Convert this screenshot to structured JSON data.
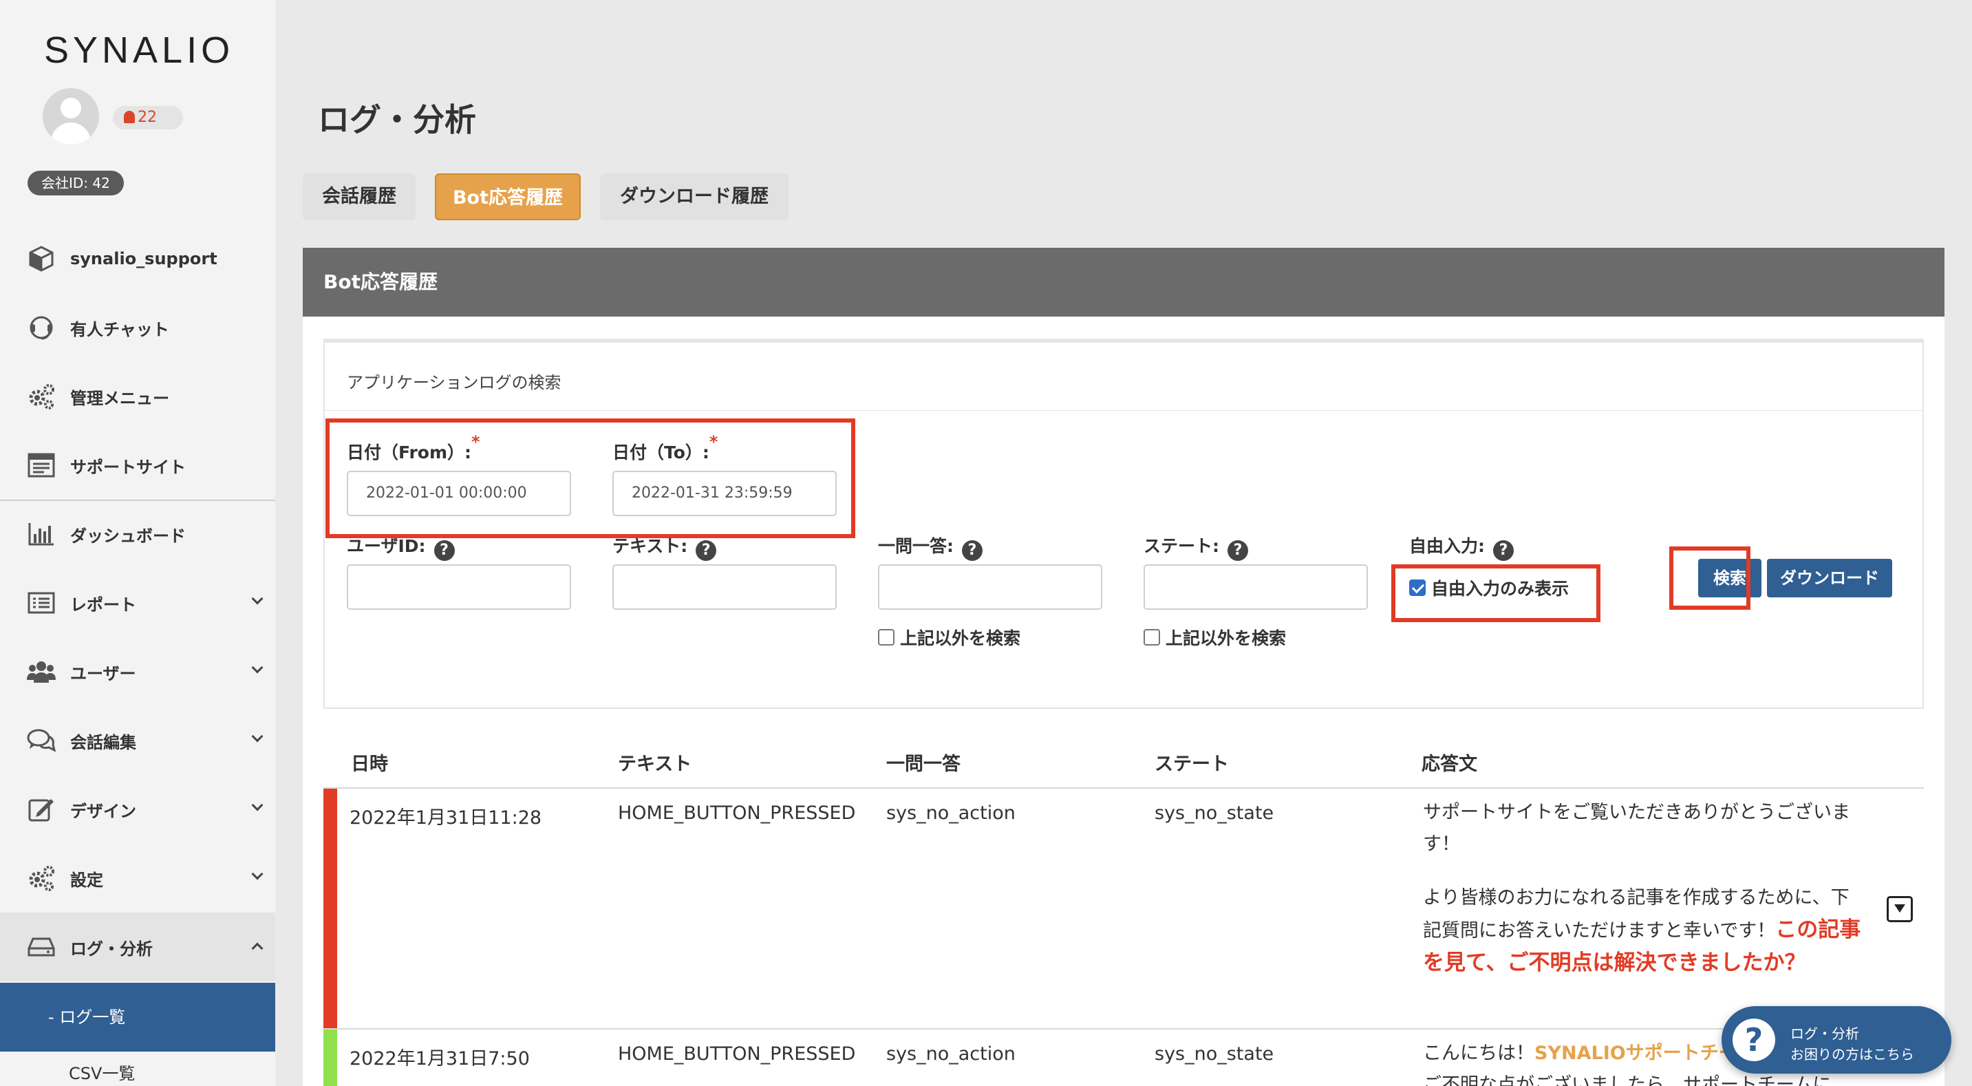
{
  "sidebar": {
    "logo": "SYNALIO",
    "notification_count": "22",
    "company_id": "会社ID: 42",
    "items": [
      {
        "label": "synalio_support",
        "icon": "cube-icon"
      },
      {
        "label": "有人チャット",
        "icon": "headset-icon"
      },
      {
        "label": "管理メニュー",
        "icon": "gears-icon"
      },
      {
        "label": "サポートサイト",
        "icon": "browser-icon"
      },
      {
        "label": "ダッシュボード",
        "icon": "bar-chart-icon"
      },
      {
        "label": "レポート",
        "icon": "list-icon"
      },
      {
        "label": "ユーザー",
        "icon": "users-icon"
      },
      {
        "label": "会話編集",
        "icon": "chat-bubbles-icon"
      },
      {
        "label": "デザイン",
        "icon": "edit-icon"
      },
      {
        "label": "設定",
        "icon": "gears-icon"
      },
      {
        "label": "ログ・分析",
        "icon": "drive-icon"
      }
    ],
    "sub_items": [
      "- ログ一覧",
      "CSV一覧"
    ]
  },
  "page": {
    "title": "ログ・分析",
    "tabs": [
      "会話履歴",
      "Bot応答履歴",
      "ダウンロード履歴"
    ],
    "active_tab": "Bot応答履歴"
  },
  "panel": {
    "title": "Bot応答履歴",
    "search_title": "アプリケーションログの検索",
    "date_from_label": "日付（From）:",
    "date_from_value": "2022-01-01 00:00:00",
    "date_to_label": "日付（To）:",
    "date_to_value": "2022-01-31 23:59:59",
    "required_mark": "*",
    "user_id_label": "ユーザID:",
    "text_label": "テキスト:",
    "qa_label": "一問一答:",
    "state_label": "ステート:",
    "free_input_label": "自由入力:",
    "help_mark": "?",
    "exclude_label": "上記以外を検索",
    "free_only_label": "自由入力のみ表示",
    "search_button": "検索",
    "download_button": "ダウンロード"
  },
  "table": {
    "headers": [
      "日時",
      "テキスト",
      "一問一答",
      "ステート",
      "応答文"
    ],
    "rows": [
      {
        "datetime": "2022年1月31日11:28",
        "text": "HOME_BUTTON_PRESSED",
        "qa": "sys_no_action",
        "state": "sys_no_state",
        "reply_p1": "サポートサイトをご覧いただきありがとうございます！",
        "reply_p2": "より皆様のお力になれる記事を作成するために、下記質問にお答えいただけますと幸いです！",
        "reply_red": "この記事を見て、ご不明点は解決できましたか？",
        "bar_color": "#e23b25"
      },
      {
        "datetime": "2022年1月31日7:50",
        "text": "HOME_BUTTON_PRESSED",
        "qa": "sys_no_action",
        "state": "sys_no_state",
        "reply_p1": "こんにちは！",
        "reply_orange": "SYNALIOサポートチーム",
        "reply_p2": "ご不明な点がございましたら、サポートチームに",
        "bar_color": "#8fe04a"
      }
    ]
  },
  "help_widget": {
    "line1": "ログ・分析",
    "line2": "お困りの方はこちら",
    "icon": "question-icon"
  },
  "colors": {
    "accent": "#e6a24a",
    "primary": "#2f5f93",
    "highlight": "#e23b25"
  }
}
